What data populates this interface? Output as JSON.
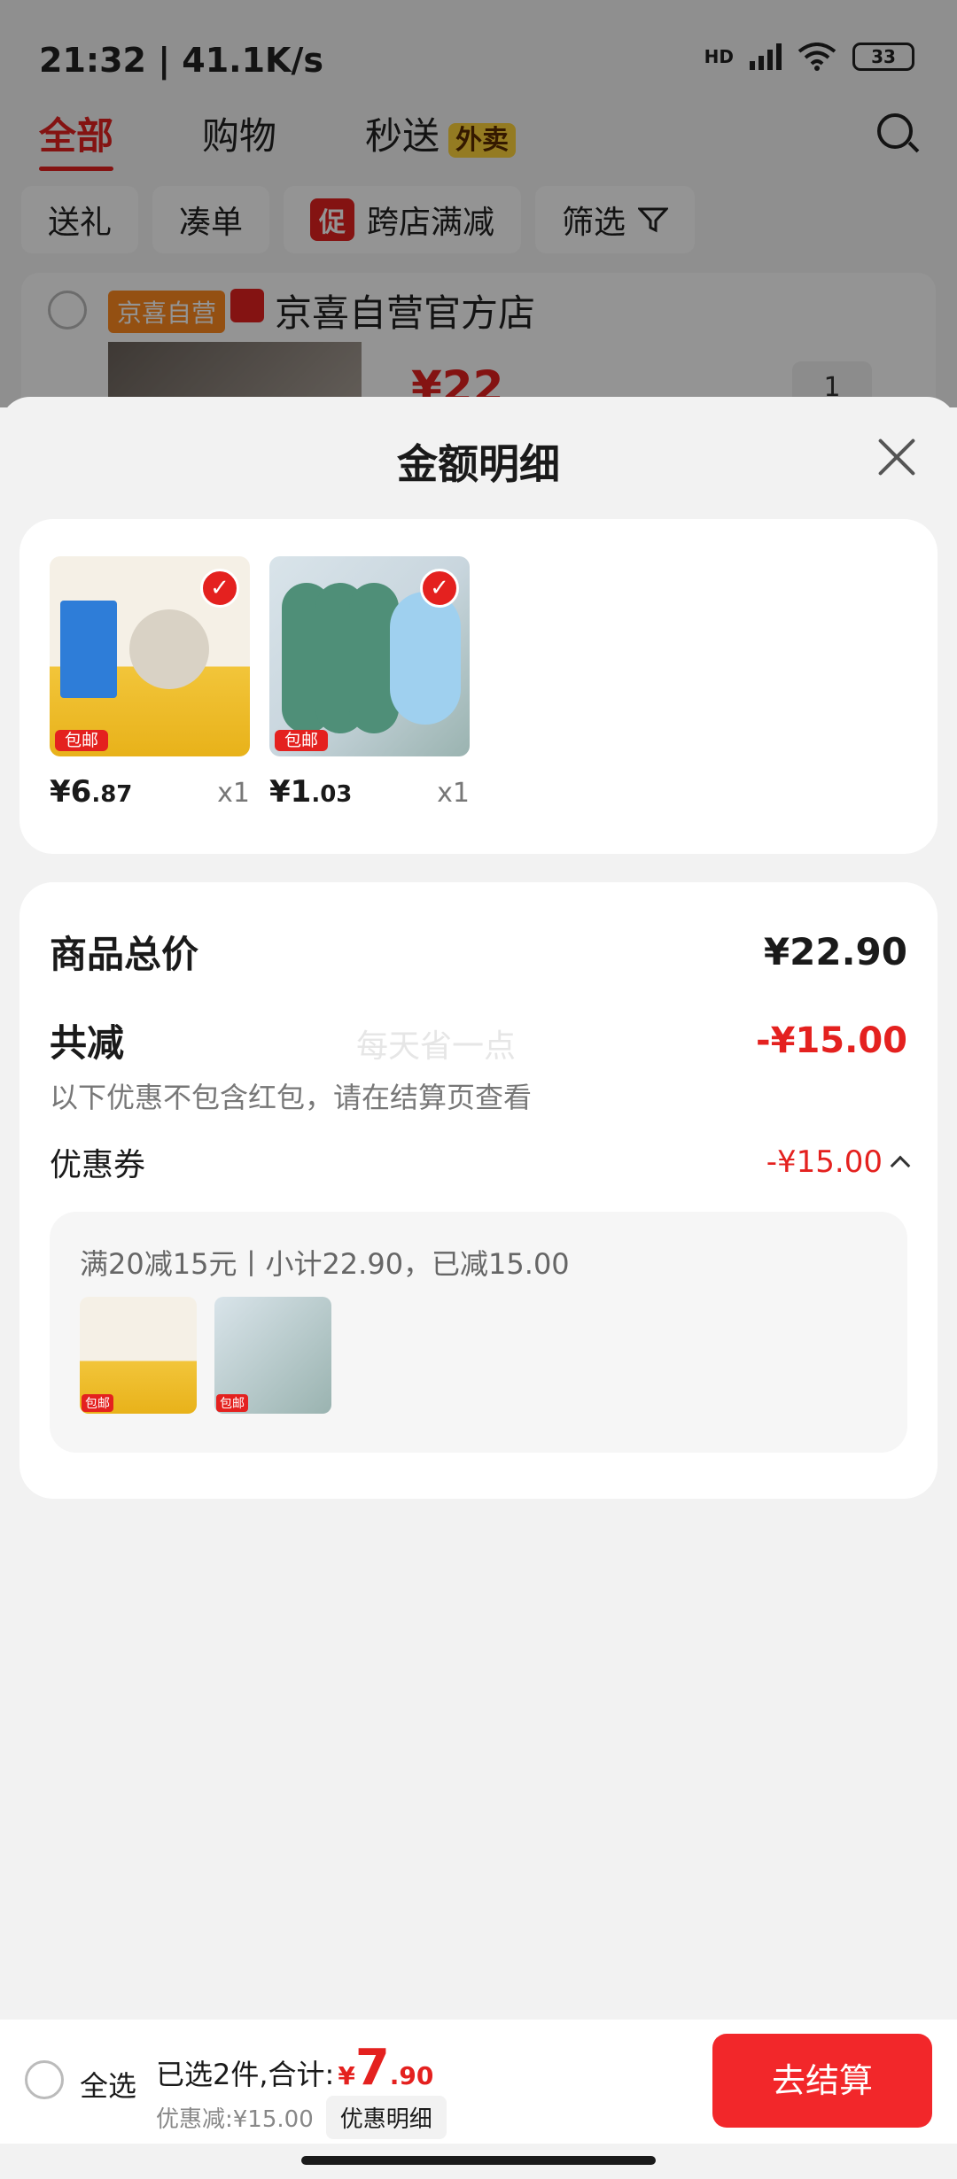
{
  "status_bar": {
    "time": "21:32 | 41.1K/s",
    "signal": "HD",
    "battery": "33"
  },
  "top_tabs": [
    {
      "label": "全部",
      "active": true
    },
    {
      "label": "购物",
      "active": false
    },
    {
      "label": "秒送",
      "badge": "外卖",
      "active": false
    }
  ],
  "filters": [
    "送礼",
    "凑单",
    "跨店满减",
    "筛选"
  ],
  "promo_tag": "促",
  "store": {
    "tag": "京喜自营",
    "name": "京喜自营官方店",
    "price_hint": "¥22",
    "qty": "1"
  },
  "sheet": {
    "title": "金额明细",
    "products": [
      {
        "currency": "¥",
        "int": "6",
        "dec": ".87",
        "qty": "x1",
        "ship_tag": "包邮"
      },
      {
        "currency": "¥",
        "int": "1",
        "dec": ".03",
        "qty": "x1",
        "ship_tag": "包邮"
      }
    ],
    "total_label": "商品总价",
    "total_value": "¥22.90",
    "reduce_label": "共减",
    "reduce_value": "-¥15.00",
    "watermark": "每天省一点",
    "reduce_note": "以下优惠不包含红包，请在结算页查看",
    "coupon_label": "优惠券",
    "coupon_value": "-¥15.00",
    "coupon_detail": "满20减15元丨小计22.90，已减15.00"
  },
  "bottom_bar": {
    "select_all": "全选",
    "selected_text": "已选2件,合计:",
    "currency": "¥",
    "amount_int": "7",
    "amount_dec": ".90",
    "discount_text": "优惠减:¥15.00",
    "discount_detail_btn": "优惠明细",
    "checkout_btn": "去结算"
  },
  "colors": {
    "accent": "#e4211f",
    "checkout": "#f2272a"
  }
}
